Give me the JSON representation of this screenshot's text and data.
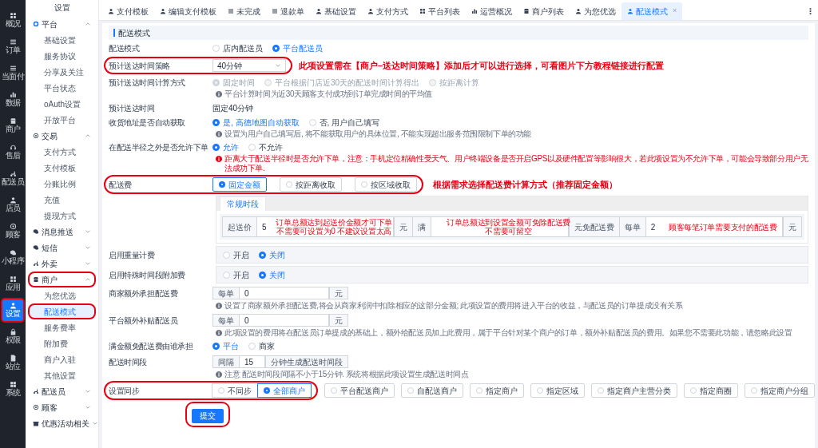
{
  "rail": [
    {
      "label": "概况",
      "selected": false,
      "circled": false
    },
    {
      "label": "订单",
      "selected": false,
      "circled": false
    },
    {
      "label": "当面付",
      "selected": false,
      "circled": false
    },
    {
      "label": "数据",
      "selected": false,
      "circled": false
    },
    {
      "label": "商户",
      "selected": false,
      "circled": false
    },
    {
      "label": "售后",
      "selected": false,
      "circled": false
    },
    {
      "label": "配送员",
      "selected": false,
      "circled": false
    },
    {
      "label": "店员",
      "selected": false,
      "circled": false
    },
    {
      "label": "顾客",
      "selected": false,
      "circled": false
    },
    {
      "label": "小程序",
      "selected": false,
      "circled": false
    },
    {
      "label": "应用",
      "selected": false,
      "circled": false
    },
    {
      "label": "设置",
      "selected": true,
      "circled": true
    },
    {
      "label": "权限",
      "selected": false,
      "circled": false
    },
    {
      "label": "站位",
      "selected": false,
      "circled": false
    },
    {
      "label": "系统",
      "selected": false,
      "circled": false
    }
  ],
  "sidebar": {
    "title": "设置",
    "groups": [
      {
        "label": "平台",
        "expanded": true,
        "circled": false,
        "children": [
          {
            "label": "基础设置",
            "selected": false,
            "circled": false
          },
          {
            "label": "服务协议",
            "selected": false,
            "circled": false
          },
          {
            "label": "分享及关注",
            "selected": false,
            "circled": false
          },
          {
            "label": "平台状态",
            "selected": false,
            "circled": false
          },
          {
            "label": "oAuth设置",
            "selected": false,
            "circled": false
          },
          {
            "label": "开放平台",
            "selected": false,
            "circled": false
          }
        ]
      },
      {
        "label": "交易",
        "expanded": true,
        "circled": false,
        "children": [
          {
            "label": "支付方式",
            "selected": false,
            "circled": false
          },
          {
            "label": "支付模板",
            "selected": false,
            "circled": false
          },
          {
            "label": "分账比例",
            "selected": false,
            "circled": false
          },
          {
            "label": "充值",
            "selected": false,
            "circled": false
          },
          {
            "label": "提现方式",
            "selected": false,
            "circled": false
          }
        ]
      },
      {
        "label": "消息推送",
        "expanded": false,
        "circled": false
      },
      {
        "label": "短信",
        "expanded": false,
        "circled": false
      },
      {
        "label": "外卖",
        "expanded": false,
        "circled": false
      },
      {
        "label": "商户",
        "expanded": true,
        "circled": true,
        "children": [
          {
            "label": "为您优选",
            "selected": false,
            "circled": false
          },
          {
            "label": "配送模式",
            "selected": true,
            "circled": true
          },
          {
            "label": "服务费率",
            "selected": false,
            "circled": false
          },
          {
            "label": "附加费",
            "selected": false,
            "circled": false
          },
          {
            "label": "商户入驻",
            "selected": false,
            "circled": false
          },
          {
            "label": "其他设置",
            "selected": false,
            "circled": false
          }
        ]
      },
      {
        "label": "配送员",
        "expanded": false,
        "circled": false
      },
      {
        "label": "顾客",
        "expanded": false,
        "circled": false
      },
      {
        "label": "优惠活动相关",
        "expanded": false,
        "circled": false
      }
    ]
  },
  "tabs": [
    {
      "label": "支付模板",
      "selected": false
    },
    {
      "label": "编辑支付模板",
      "selected": false
    },
    {
      "label": "未完成",
      "selected": false
    },
    {
      "label": "退款单",
      "selected": false
    },
    {
      "label": "基础设置",
      "selected": false
    },
    {
      "label": "支付方式",
      "selected": false
    },
    {
      "label": "平台列表",
      "selected": false
    },
    {
      "label": "运营概况",
      "selected": false
    },
    {
      "label": "商户列表",
      "selected": false
    },
    {
      "label": "为您优选",
      "selected": false
    },
    {
      "label": "配送模式",
      "selected": true,
      "close": "×"
    }
  ],
  "form": {
    "title": "配送模式",
    "rows": [
      {
        "kind": "radio",
        "label": "配送模式",
        "options": [
          {
            "label": "店内配送员",
            "selected": false
          },
          {
            "label": "平台配送员",
            "selected": true
          }
        ]
      },
      {
        "kind": "select",
        "label": "预计送达时间策略",
        "value": "40分钟",
        "circled": true,
        "note": "此项设置需在【商户–送达时间策略】添加后才可以进行选择，可看图片下方教程链接进行配置"
      },
      {
        "kind": "radio",
        "label": "预计送达时间计算方式",
        "options": [
          {
            "label": "固定时间",
            "selected": true,
            "disabled": true
          },
          {
            "label": "平台根据门店近30天的配送时间计算得出",
            "selected": false,
            "disabled": true
          },
          {
            "label": "按距离计算",
            "selected": false,
            "disabled": true
          }
        ],
        "hint": {
          "kind": "info",
          "text": "平台计算时间为近30天顾客支付成功到订单完成时间的平均值"
        }
      },
      {
        "kind": "text",
        "label": "预计送达时间",
        "value": "固定40分钟"
      },
      {
        "kind": "radio",
        "label": "收货地址是否自动获取",
        "options": [
          {
            "label": "是, 高德地图自动获取",
            "selected": true
          },
          {
            "label": "否, 用户自己填写",
            "selected": false
          }
        ],
        "hint": {
          "kind": "info",
          "text": "设置为用户自己填写后, 将不能获取用户的具体位置, 不能实现超出服务范围限制下单的功能"
        }
      },
      {
        "kind": "radio",
        "label": "在配送半径之外是否允许下单",
        "options": [
          {
            "label": "允许",
            "selected": true
          },
          {
            "label": "不允许",
            "selected": false
          }
        ],
        "hint": {
          "kind": "warning",
          "text": "距离大于配送半径时是否允许下单，注意：手机定位精确性受天气、用户终端设备是否开启GPS以及硬件配置等影响很大，若此项设置为不允许下单，可能会导致部分用户无法成功下单."
        }
      },
      {
        "kind": "segments",
        "label": "配送费",
        "circled": true,
        "options": [
          {
            "label": "固定金额",
            "selected": true
          },
          {
            "label": "按距离收取",
            "selected": false
          },
          {
            "label": "按区域收取",
            "selected": false
          }
        ],
        "note": "根据需求选择配送费计算方式（推荐固定金额）"
      },
      {
        "kind": "panel",
        "tabs": [
          {
            "label": "常规时段",
            "selected": true
          }
        ],
        "parts": [
          {
            "kind": "addon",
            "text": "起送价"
          },
          {
            "kind": "input",
            "value": "5",
            "note": [
              "订单总额达到起送价金额才可下单",
              "不需要可设置为0 不建议设置太高"
            ]
          },
          {
            "kind": "addon",
            "text": "元"
          },
          {
            "kind": "addon",
            "text": "满"
          },
          {
            "kind": "input",
            "note": [
              "订单总额达到设置金额可免除配送费",
              "不需要可留空"
            ]
          },
          {
            "kind": "addon",
            "text": "元免配送费"
          },
          {
            "kind": "addon",
            "text": "每单"
          },
          {
            "kind": "input",
            "value": "2",
            "note": [
              "顾客每笔订单需要支付的配送费"
            ]
          },
          {
            "kind": "addon",
            "text": "元"
          }
        ]
      },
      {
        "kind": "boxed",
        "label": "启用重量计费",
        "options": [
          {
            "label": "开启",
            "selected": false
          },
          {
            "label": "关闭",
            "selected": true
          }
        ]
      },
      {
        "kind": "boxed",
        "label": "启用特殊时间段附加费",
        "options": [
          {
            "label": "开启",
            "selected": false
          },
          {
            "label": "关闭",
            "selected": true
          }
        ]
      },
      {
        "kind": "group",
        "label": "商家额外承担配送费",
        "parts": [
          {
            "kind": "addon",
            "text": "每单"
          },
          {
            "kind": "input",
            "value": "0"
          },
          {
            "kind": "addon",
            "text": "元"
          }
        ],
        "hint": {
          "kind": "info",
          "text": "设置了商家额外承担配送费,将会从商家利润中扣除相应的这部分金额; 此项设置的费用将进入平台的收益，与配送员的订单提成没有关系"
        }
      },
      {
        "kind": "group",
        "label": "平台额外补贴配送员",
        "parts": [
          {
            "kind": "addon",
            "text": "每单"
          },
          {
            "kind": "input",
            "value": "0"
          },
          {
            "kind": "addon",
            "text": "元"
          }
        ],
        "hint": {
          "kind": "info",
          "text": "此项设置的费用将在配送员订单提成的基础上，额外给配送员加上此费用，属于平台针对某个商户的订单，额外补贴配送员的费用。如果您不需要此功能，请忽略此设置"
        }
      },
      {
        "kind": "radio",
        "label": "满金额免配送费由谁承担",
        "options": [
          {
            "label": "平台",
            "selected": true
          },
          {
            "label": "商家",
            "selected": false
          }
        ]
      },
      {
        "kind": "group",
        "label": "配送时间段",
        "parts": [
          {
            "kind": "addon",
            "text": "间隔"
          },
          {
            "kind": "input",
            "value": "15"
          },
          {
            "kind": "addon",
            "text": "分钟生成配送时间段"
          }
        ],
        "hint": {
          "kind": "info",
          "text": "注意 配送时间段间隔不小于15分钟. 系统将根据此项设置生成配送时间点"
        }
      },
      {
        "kind": "sync",
        "label": "设置同步",
        "circled": true,
        "options": [
          {
            "label": "不同步",
            "selected": false,
            "joined": true
          },
          {
            "label": "全部商户",
            "selected": true,
            "joined": true
          },
          {
            "label": "平台配送商户",
            "selected": false,
            "joined": false
          },
          {
            "label": "自配送商户",
            "selected": false,
            "joined": false
          },
          {
            "label": "指定商户",
            "selected": false,
            "joined": false
          },
          {
            "label": "指定区域",
            "selected": false,
            "joined": false
          },
          {
            "label": "指定商户主营分类",
            "selected": false,
            "joined": false
          },
          {
            "label": "指定商圈",
            "selected": false,
            "joined": false
          },
          {
            "label": "指定商户分组",
            "selected": false,
            "joined": false
          }
        ]
      },
      {
        "kind": "submit",
        "label": "提交",
        "circled": true
      }
    ]
  }
}
